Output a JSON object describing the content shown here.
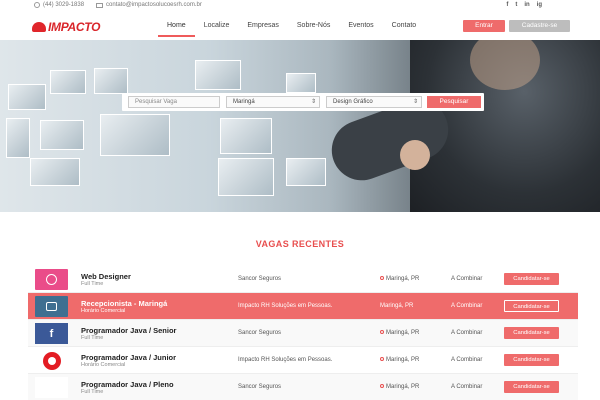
{
  "topbar": {
    "phone": "(44) 3029-1838",
    "email": "contato@impactosolucoesrh.com.br",
    "socials": [
      "f",
      "t",
      "in",
      "ig"
    ]
  },
  "brand": {
    "logo_text": "IMPACTO"
  },
  "nav": {
    "items": [
      "Home",
      "Localize",
      "Empresas",
      "Sobre-Nós",
      "Eventos",
      "Contato"
    ],
    "active": "Home",
    "login_label": "Entrar",
    "signup_label": "Cadastre-se"
  },
  "search": {
    "query_placeholder": "Pesquisar Vaga",
    "city_value": "Maringá",
    "area_value": "Design Gráfico",
    "button_label": "Pesquisar"
  },
  "section": {
    "title": "VAGAS RECENTES"
  },
  "jobs": [
    {
      "title": "Web Designer",
      "schedule": "Full Time",
      "company": "Sancor Seguros",
      "city": "Maringá, PR",
      "salary": "A Combinar",
      "apply": "Candidatar-se",
      "logo": "dribbble-icon"
    },
    {
      "title": "Recepcionista - Maringá",
      "schedule": "Horário Comercial",
      "company": "Impacto RH Soluções em Pessoas.",
      "city": "Maringá, PR",
      "salary": "A Combinar",
      "apply": "Candidatar-se",
      "logo": "instagram-icon"
    },
    {
      "title": "Programador Java / Senior",
      "schedule": "Full Time",
      "company": "Sancor Seguros",
      "city": "Maringá, PR",
      "salary": "A Combinar",
      "apply": "Candidatar-se",
      "logo": "facebook-icon"
    },
    {
      "title": "Programador Java / Junior",
      "schedule": "Horário Comercial",
      "company": "Impacto RH Soluções em Pessoas.",
      "city": "Maringá, PR",
      "salary": "A Combinar",
      "apply": "Candidatar-se",
      "logo": "beats-icon"
    },
    {
      "title": "Programador Java / Pleno",
      "schedule": "Full Time",
      "company": "Sancor Seguros",
      "city": "Maringá, PR",
      "salary": "A Combinar",
      "apply": "Candidatar-se",
      "logo": "windows-icon"
    }
  ],
  "colors": {
    "accent": "#ef6b6b",
    "brand": "#d9252a",
    "highlight_row": "#ef6b6b"
  }
}
